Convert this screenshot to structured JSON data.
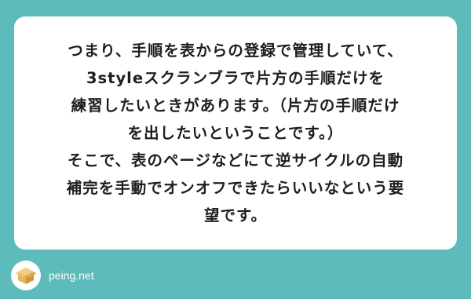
{
  "question": {
    "lines": [
      "つまり、手順を表からの登録で管理していて、",
      "3styleスクランブラで片方の手順だけを",
      "練習したいときがあります。（片方の手順だけ",
      "を出したいということです。）",
      "そこで、表のページなどにて逆サイクルの自動",
      "補完を手動でオンオフできたらいいなという要",
      "望です。"
    ]
  },
  "footer": {
    "logo_icon": "cardboard-box-icon",
    "brand": "peing.net"
  },
  "colors": {
    "background": "#5ebbbb",
    "card": "#ffffff",
    "text": "#1e1e1e",
    "box": "#e6b25c"
  }
}
